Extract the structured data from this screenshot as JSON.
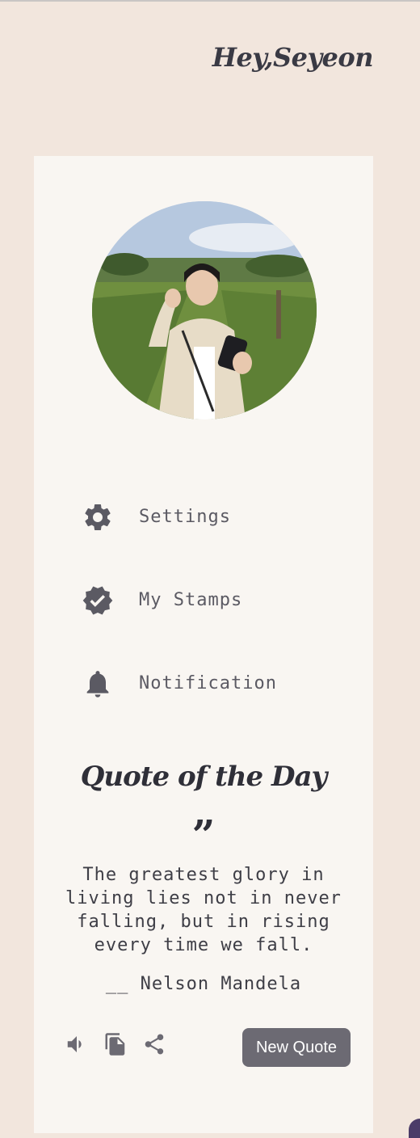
{
  "header": {
    "greeting": "Hey,Seyeon"
  },
  "profile": {
    "avatar_icon": "user-photo"
  },
  "menu": {
    "items": [
      {
        "label": "Settings",
        "icon": "gear-icon"
      },
      {
        "label": "My Stamps",
        "icon": "verified-badge-icon"
      },
      {
        "label": "Notification",
        "icon": "bell-icon"
      }
    ]
  },
  "quote": {
    "title": "Quote of the Day",
    "mark": "”",
    "lines": [
      "The greatest glory in",
      "living lies not in never",
      "falling, but in rising",
      "every time we fall."
    ],
    "author": "__ Nelson Mandela",
    "new_quote_label": "New Quote"
  },
  "actions": [
    "speaker-icon",
    "copy-icon",
    "share-icon"
  ],
  "colors": {
    "background": "#f2e6dd",
    "card": "#f9f6f2",
    "text": "#3e3e46",
    "icon": "#5b5a63",
    "button": "#6c6a73"
  }
}
